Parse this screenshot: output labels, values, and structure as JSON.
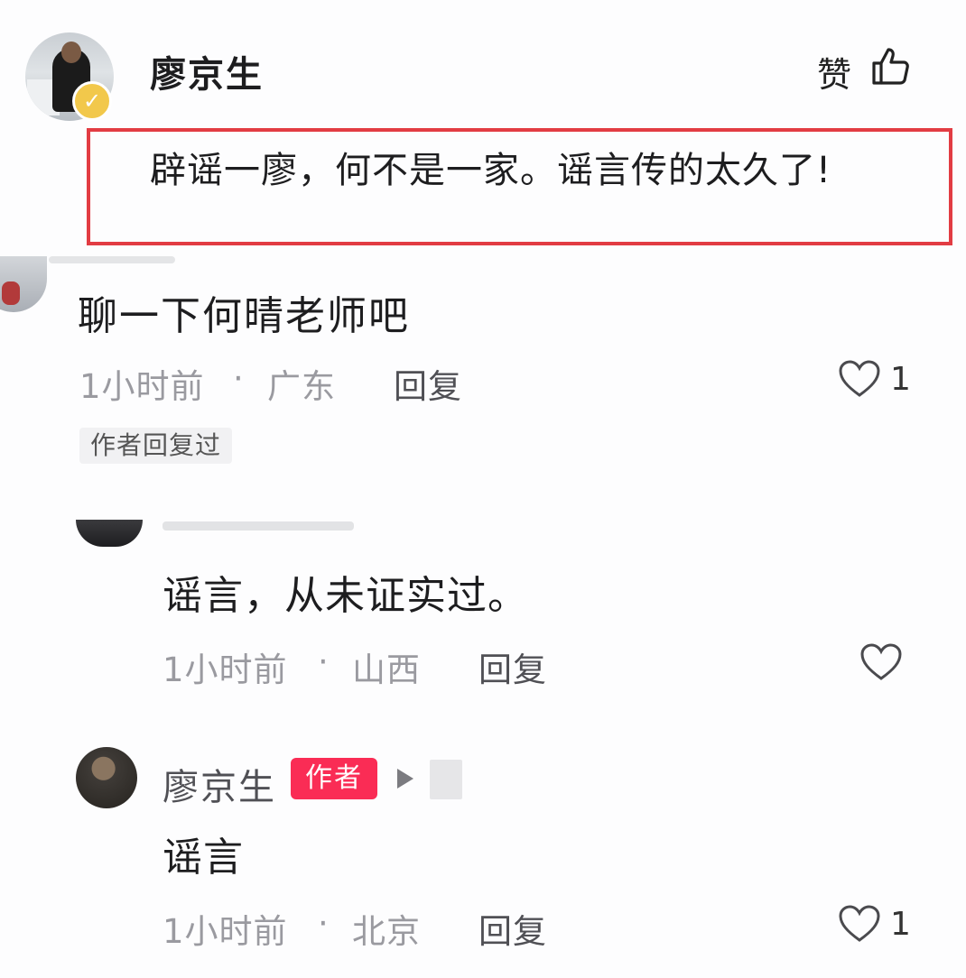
{
  "top_comment": {
    "user_name": "廖京生",
    "like_label": "赞",
    "text": "辟谣一廖，何不是一家。谣言传的太久了!"
  },
  "comment": {
    "text": "聊一下何晴老师吧",
    "time": "1小时前",
    "separator": "·",
    "location": "广东",
    "reply_label": "回复",
    "like_count": "1",
    "author_replied_tag": "作者回复过"
  },
  "replies": [
    {
      "text": "谣言，从未证实过。",
      "time": "1小时前",
      "separator": "·",
      "location": "山西",
      "reply_label": "回复",
      "like_count": ""
    },
    {
      "user_name": "廖京生",
      "author_tag": "作者",
      "text": "谣言",
      "time": "1小时前",
      "separator": "·",
      "location": "北京",
      "reply_label": "回复",
      "like_count": "1"
    }
  ],
  "colors": {
    "highlight_border": "#e23c43",
    "author_tag_bg": "#fa2c55",
    "meta_text": "#9a9aa0"
  },
  "icons": [
    "thumbs-up-icon",
    "heart-icon",
    "play-icon",
    "verified-icon"
  ]
}
